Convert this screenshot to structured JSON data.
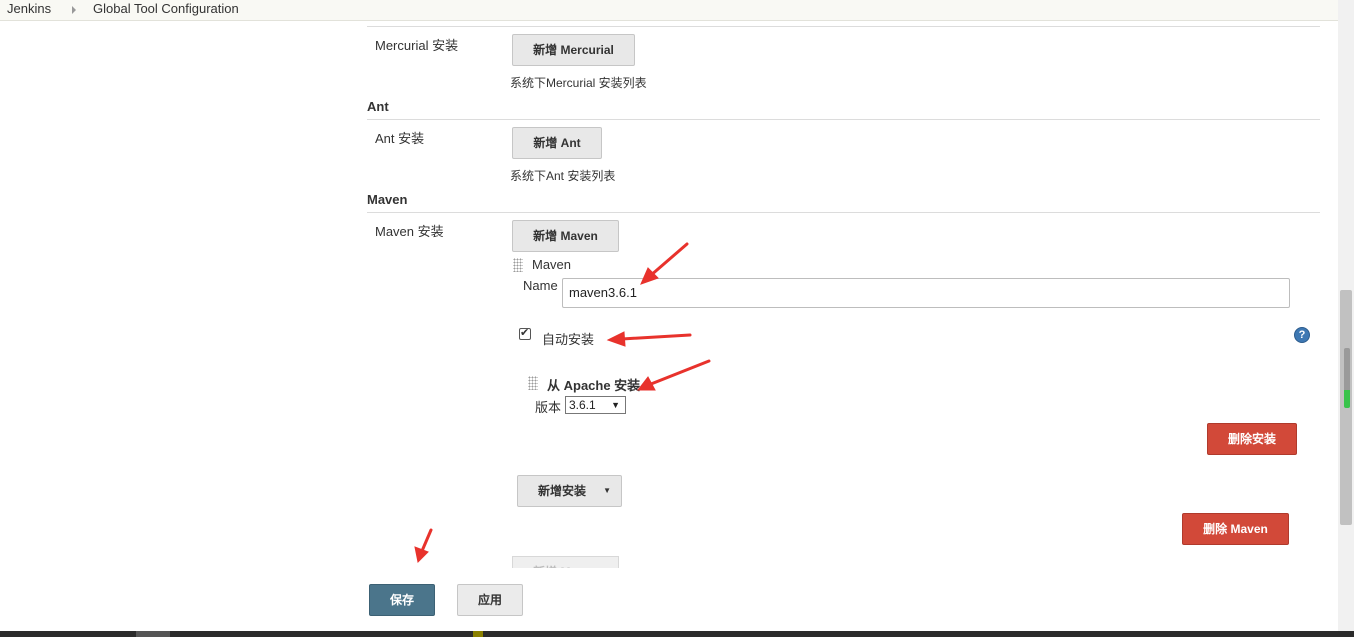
{
  "breadcrumb": {
    "root": "Jenkins",
    "page": "Global Tool Configuration"
  },
  "mercurial": {
    "install_label": "Mercurial 安装",
    "add_button": "新增 Mercurial",
    "list_desc": "系统下Mercurial 安装列表"
  },
  "ant": {
    "section_title": "Ant",
    "install_label": "Ant 安装",
    "add_button": "新增 Ant",
    "list_desc": "系统下Ant 安装列表"
  },
  "maven": {
    "section_title": "Maven",
    "install_label": "Maven 安装",
    "add_button": "新增 Maven",
    "item_title": "Maven",
    "name_label": "Name",
    "name_value": "maven3.6.1",
    "auto_install_label": "自动安装",
    "auto_install_checked": true,
    "installer_title": "从 Apache 安装",
    "version_label": "版本",
    "version_value": "3.6.1",
    "delete_installer_button": "删除安装",
    "add_installer_button": "新增安装",
    "delete_maven_button": "删除 Maven",
    "add_button_bottom": "新增 Maven"
  },
  "footer": {
    "save_button": "保存",
    "apply_button": "应用"
  },
  "colors": {
    "annotation_arrow": "#e8322c",
    "danger": "#d24939",
    "primary": "#4b758b",
    "help": "#3e78b3"
  },
  "icons": {
    "help": "help-icon",
    "drag": "drag-handle-icon",
    "dropdown": "caret-down-icon"
  }
}
